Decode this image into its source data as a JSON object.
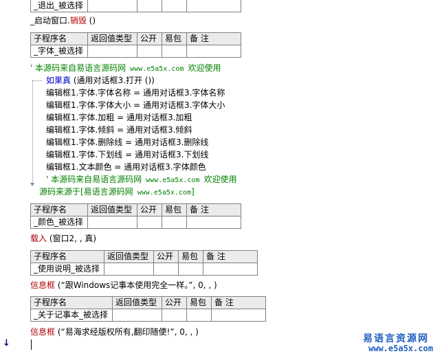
{
  "top_table": {
    "row_name": "_退出_被选择"
  },
  "line_destroy": {
    "obj": "_启动窗口.",
    "fn": "销毁",
    "args": " ()"
  },
  "table_headers": {
    "name": "子程序名",
    "return_type": "返回值类型",
    "public": "公开",
    "easy_pkg": "易包",
    "note": "备 注"
  },
  "table_font": {
    "row_name": "_字体_被选择"
  },
  "comment_source_1": {
    "text": "' 本源码来自易语言源码网",
    "url": " www.e5a5x.com ",
    "tail": " 欢迎使用"
  },
  "if_block": {
    "keyword": "如果真",
    "condition": " (通用对话框3.打开 ())",
    "lines": [
      "编辑框1.字体.字体名称 = 通用对话框3.字体名称",
      "编辑框1.字体.字体大小 = 通用对话框3.字体大小",
      "编辑框1.字体.加粗 = 通用对话框3.加粗",
      "编辑框1.字体.倾斜 = 通用对话框3.倾斜",
      "编辑框1.字体.删除线 = 通用对话框3.删除线",
      "编辑框1.字体.下划线 = 通用对话框3.下划线",
      "编辑框1.文本颜色 = 通用对话框3.字体颜色"
    ],
    "inner_comment": {
      "text": "' 本源码来自易语言源码网",
      "url": " www.e5a5x.com ",
      "tail": " 欢迎使用"
    }
  },
  "comment_source_2": {
    "text": "源码来源于[易语言源码网",
    "url": " www.e5a5x.com",
    "tail": "]"
  },
  "table_color": {
    "row_name": "_颜色_被选择"
  },
  "line_load": {
    "fn": "载入",
    "args": " (窗口2, , 真)"
  },
  "table_usage": {
    "row_name": "_使用说明_被选择"
  },
  "line_msg_1": {
    "fn": "信息框",
    "args": " (“跟Windows记事本使用完全一样。”, 0, , )"
  },
  "table_about": {
    "row_name": "_关于记事本_被选择"
  },
  "line_msg_2": {
    "fn": "信息框",
    "args": " (“易海求经版权所有,翻印随便!”, 0, , )"
  },
  "watermark": {
    "cn": "易语言资源网",
    "en": "www.e5a5x.com"
  },
  "margin_marker": "↓"
}
